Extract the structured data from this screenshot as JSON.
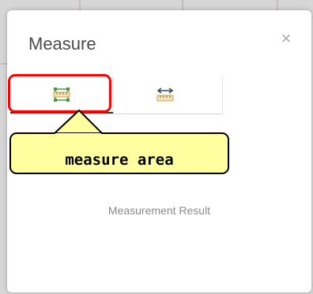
{
  "window": {
    "title": "Measure",
    "close_glyph": "×"
  },
  "tabs": [
    {
      "icon": "measure-area-icon",
      "active": true
    },
    {
      "icon": "measure-distance-icon",
      "active": false
    }
  ],
  "callout": {
    "text": "measure area",
    "highlight_color": "#ff0000",
    "fill_color": "#ffffa0"
  },
  "result": {
    "label": "Measurement Result"
  },
  "colors": {
    "icon_green": "#4a9a3a",
    "icon_ruler": "#caa45a"
  }
}
